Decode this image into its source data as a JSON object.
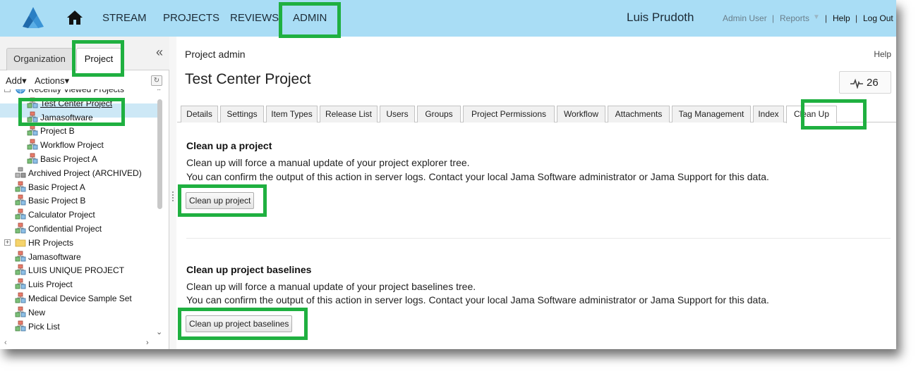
{
  "nav": {
    "links": [
      "STREAM",
      "PROJECTS",
      "REVIEWS",
      "ADMIN"
    ],
    "user_name": "Luis Prudoth",
    "admin_user": "Admin User",
    "separator": "|",
    "reports": "Reports",
    "help": "Help",
    "logout": "Log Out"
  },
  "left_panel": {
    "tabs": [
      "Organization",
      "Project"
    ],
    "collapse_glyph": "«",
    "add_label": "Add▾",
    "actions_label": "Actions▾",
    "tree_items": [
      {
        "label": "Recently Viewed Projects",
        "indent": 1,
        "icon": "globe-icon"
      },
      {
        "label": "Test Center Project",
        "indent": 2,
        "icon": "project-icon",
        "selected": true
      },
      {
        "label": "Jamasoftware",
        "indent": 2,
        "icon": "project-icon"
      },
      {
        "label": "Project B",
        "indent": 2,
        "icon": "project-icon"
      },
      {
        "label": "Workflow Project",
        "indent": 2,
        "icon": "project-icon"
      },
      {
        "label": "Basic Project A",
        "indent": 2,
        "icon": "project-icon"
      },
      {
        "label": "Archived Project (ARCHIVED)",
        "indent": 1,
        "icon": "archived-project-icon"
      },
      {
        "label": "Basic Project A",
        "indent": 1,
        "icon": "project-icon"
      },
      {
        "label": "Basic Project B",
        "indent": 1,
        "icon": "project-icon"
      },
      {
        "label": "Calculator Project",
        "indent": 1,
        "icon": "project-icon"
      },
      {
        "label": "Confidential Project",
        "indent": 1,
        "icon": "project-icon"
      },
      {
        "label": "HR Projects",
        "indent": 1,
        "icon": "folder-icon",
        "expandable": true
      },
      {
        "label": "Jamasoftware",
        "indent": 1,
        "icon": "project-icon"
      },
      {
        "label": "LUIS UNIQUE PROJECT",
        "indent": 1,
        "icon": "project-icon"
      },
      {
        "label": "Luis Project",
        "indent": 1,
        "icon": "project-icon"
      },
      {
        "label": "Medical Device Sample Set",
        "indent": 1,
        "icon": "project-icon"
      },
      {
        "label": "New",
        "indent": 1,
        "icon": "project-icon"
      },
      {
        "label": "Pick List",
        "indent": 1,
        "icon": "project-icon"
      }
    ]
  },
  "main": {
    "breadcrumb": "Project admin",
    "help": "Help",
    "title": "Test Center Project",
    "activity_count": "26",
    "tabs": [
      "Details",
      "Settings",
      "Item Types",
      "Release List",
      "Users",
      "Groups",
      "Project Permissions",
      "Workflow",
      "Attachments",
      "Tag Management",
      "Index",
      "Clean Up"
    ],
    "active_tab": "Clean Up",
    "sections": [
      {
        "title": "Clean up a project",
        "line1": "Clean up will force a manual update of your project explorer tree.",
        "line2": "You can confirm the output of this action in server logs. Contact your local Jama Software administrator or Jama Support for this data.",
        "button": "Clean up project"
      },
      {
        "title": "Clean up project baselines",
        "line1": "Clean up will force a manual update of your project baselines tree.",
        "line2": "You can confirm the output of this action in server logs. Contact your local Jama Software administrator or Jama Support for this data.",
        "button": "Clean up project baselines"
      }
    ]
  },
  "colors": {
    "nav_bg": "#a9ddf5",
    "highlight": "#1fb040",
    "selected_row": "#cde8f6"
  }
}
